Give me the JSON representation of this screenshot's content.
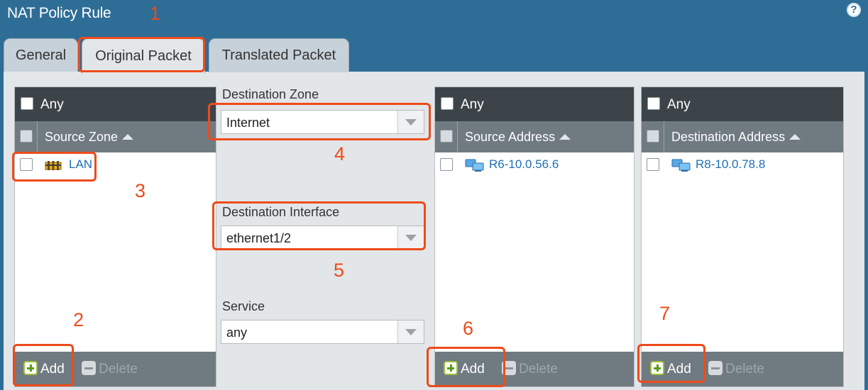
{
  "dialog": {
    "title": "NAT Policy Rule",
    "help_symbol": "?"
  },
  "tabs": [
    {
      "label": "General"
    },
    {
      "label": "Original Packet"
    },
    {
      "label": "Translated Packet"
    }
  ],
  "source_zone_panel": {
    "any_label": "Any",
    "column_header": "Source Zone",
    "items": [
      {
        "label": "LAN",
        "icon": "zone-icon"
      }
    ],
    "add_label": "Add",
    "delete_label": "Delete"
  },
  "destination_zone": {
    "label": "Destination Zone",
    "value": "Internet"
  },
  "destination_interface": {
    "label": "Destination Interface",
    "value": "ethernet1/2"
  },
  "service": {
    "label": "Service",
    "value": "any"
  },
  "source_address_panel": {
    "any_label": "Any",
    "column_header": "Source Address",
    "items": [
      {
        "label": "R6-10.0.56.6",
        "icon": "address-icon"
      }
    ],
    "add_label": "Add",
    "delete_label": "Delete"
  },
  "destination_address_panel": {
    "any_label": "Any",
    "column_header": "Destination Address",
    "items": [
      {
        "label": "R8-10.0.78.8",
        "icon": "address-icon"
      }
    ],
    "add_label": "Add",
    "delete_label": "Delete"
  },
  "annotations": [
    "1",
    "2",
    "3",
    "4",
    "5",
    "6",
    "7"
  ],
  "colors": {
    "annotation": "#ee4b1a",
    "header_bg": "#2e6d96",
    "link": "#1e6fb5"
  }
}
